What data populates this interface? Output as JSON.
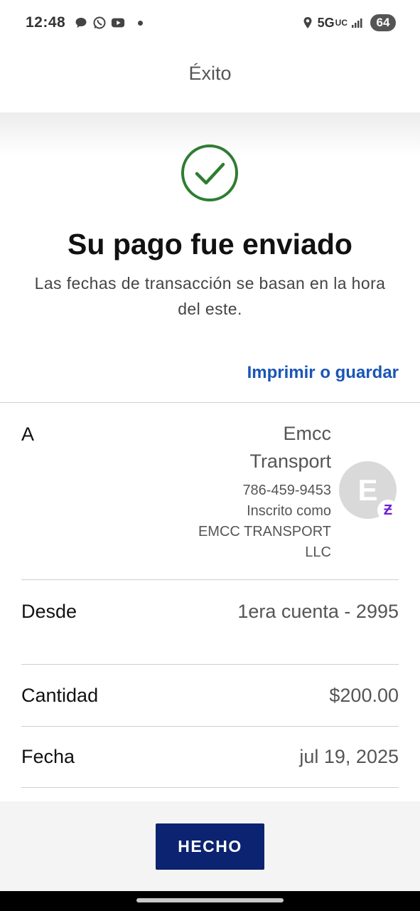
{
  "status_bar": {
    "time": "12:48",
    "left_icons": [
      "chat-bubble-icon",
      "whatsapp-icon",
      "youtube-icon",
      "notification-dot-icon"
    ],
    "network": "5G",
    "network_sub": "UC",
    "battery": "64"
  },
  "header": {
    "title": "Éxito"
  },
  "success": {
    "icon": "check-circle-icon",
    "icon_color": "#2e7d32",
    "title": "Su pago fue enviado",
    "subtitle": "Las fechas de transacción se basan en la hora del este.",
    "print_link": "Imprimir o guardar"
  },
  "details": {
    "to": {
      "label": "A",
      "name_line1": "Emcc",
      "name_line2": "Transport",
      "phone": "786-459-9453",
      "enrolled_line1": "Inscrito como",
      "enrolled_line2": "EMCC TRANSPORT",
      "enrolled_line3": "LLC",
      "avatar_letter": "E",
      "badge_symbol": "Ƶ"
    },
    "from": {
      "label": "Desde",
      "value": "1era cuenta - 2995"
    },
    "amount": {
      "label": "Cantidad",
      "value": "$200.00"
    },
    "date": {
      "label": "Fecha",
      "value": "jul 19, 2025"
    }
  },
  "actions": {
    "done_label": "HECHO",
    "done_color": "#0b2370"
  },
  "colors": {
    "link": "#1a55b5",
    "zelle": "#6d1ed4"
  }
}
